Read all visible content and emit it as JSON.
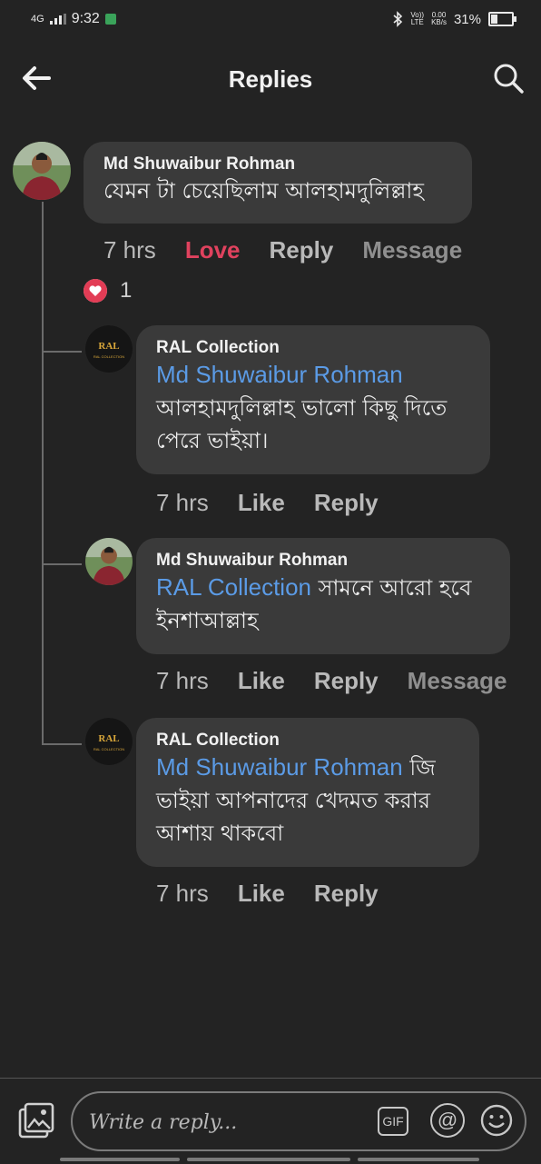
{
  "status": {
    "network": "4G",
    "time": "9:32",
    "volte_top": "Vo))",
    "volte_bottom": "LTE",
    "speed_top": "0.00",
    "speed_bottom": "KB/s",
    "battery": "31%"
  },
  "header": {
    "title": "Replies"
  },
  "comments": [
    {
      "name": "Md Shuwaibur Rohman",
      "mention": "",
      "text": "যেমন টা চেয়েছিলাম আলহামদুলিল্লাহ",
      "time": "7 hrs",
      "action1": "Love",
      "action2": "Reply",
      "action3": "Message",
      "reaction_count": "1"
    },
    {
      "name": "RAL Collection",
      "mention": "Md Shuwaibur Rohman",
      "text": "আলহামদুলিল্লাহ ভালো কিছু দিতে পেরে ভাইয়া।",
      "time": "7 hrs",
      "action1": "Like",
      "action2": "Reply"
    },
    {
      "name": "Md Shuwaibur Rohman",
      "mention": "RAL Collection",
      "text": "সামনে আরো হবে ইনশাআল্লাহ",
      "time": "7 hrs",
      "action1": "Like",
      "action2": "Reply",
      "action3": "Message"
    },
    {
      "name": "RAL Collection",
      "mention": "Md Shuwaibur Rohman",
      "text": "জি ভাইয়া আপনাদের খেদমত করার আশায় থাকবো",
      "time": "7 hrs",
      "action1": "Like",
      "action2": "Reply"
    }
  ],
  "logo_text": "RAL",
  "logo_sub": "RAL COLLECTION",
  "composer": {
    "placeholder": "Write a reply...",
    "gif": "GIF",
    "at": "@"
  },
  "colors": {
    "background": "#232323",
    "bubble": "#3a3a3a",
    "mention": "#5b9be6",
    "love": "#e0425e"
  }
}
